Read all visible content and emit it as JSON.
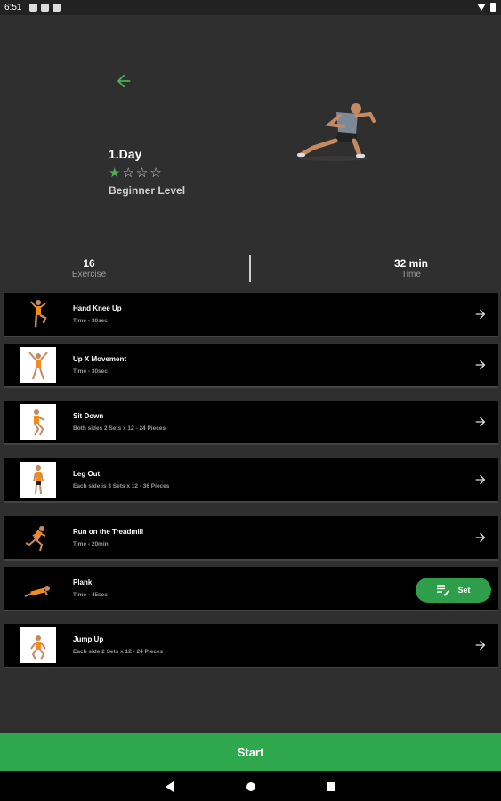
{
  "status_bar": {
    "time": "6:51"
  },
  "header": {
    "day_title": "1.Day",
    "rating": {
      "filled": 1,
      "total": 4
    },
    "level": "Beginner Level"
  },
  "stats": {
    "exercise_count": "16",
    "exercise_label": "Exercise",
    "time_value": "32 min",
    "time_label": "Time"
  },
  "exercises": [
    {
      "name": "Hand Knee Up",
      "detail": "Time - 30sec"
    },
    {
      "name": "Up X Movement",
      "detail": "Time - 30sec"
    },
    {
      "name": "Sit Down",
      "detail": "Both sides 2 Sets x 12 - 24 Pieces"
    },
    {
      "name": "Leg Out",
      "detail": "Each side is 3 Sets x 12 - 36 Pieces"
    },
    {
      "name": "Run on the Treadmill",
      "detail": "Time - 20min"
    },
    {
      "name": "Plank",
      "detail": "Time - 45sec",
      "action_label": "Set"
    },
    {
      "name": "Jump Up",
      "detail": "Each side 2 Sets x 12 - 24 Pieces"
    }
  ],
  "start_label": "Start",
  "colors": {
    "accent": "#2fa84d",
    "background": "#2f2f2f",
    "row": "#000000"
  }
}
